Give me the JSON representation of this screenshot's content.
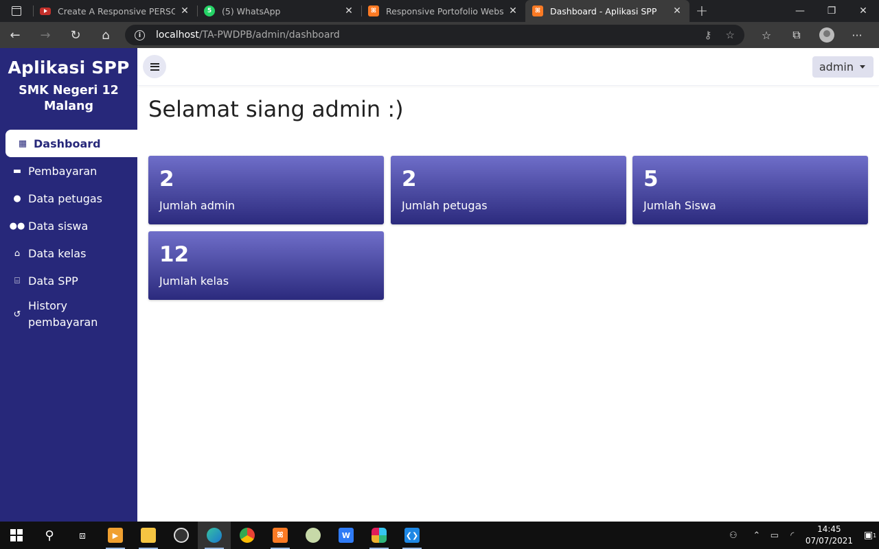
{
  "browser": {
    "tabs": [
      {
        "title": "Create A Responsive PERSONAL",
        "favicon": "youtube-icon",
        "active": false
      },
      {
        "title": "(5) WhatsApp",
        "favicon": "whatsapp-icon",
        "active": false
      },
      {
        "title": "Responsive Portofolio Website",
        "favicon": "xampp-icon",
        "active": false
      },
      {
        "title": "Dashboard - Aplikasi SPP",
        "favicon": "xampp-icon",
        "active": true
      }
    ],
    "url_host": "localhost",
    "url_path": "/TA-PWDPB/admin/dashboard",
    "whatsapp_badge": "5"
  },
  "sidebar": {
    "app_name": "Aplikasi SPP",
    "school": "SMK Negeri 12 Malang",
    "items": [
      {
        "label": "Dashboard",
        "icon": "grid-icon",
        "active": true
      },
      {
        "label": "Pembayaran",
        "icon": "card-icon",
        "active": false
      },
      {
        "label": "Data petugas",
        "icon": "user-icon",
        "active": false
      },
      {
        "label": "Data siswa",
        "icon": "users-icon",
        "active": false
      },
      {
        "label": "Data kelas",
        "icon": "school-icon",
        "active": false
      },
      {
        "label": "Data SPP",
        "icon": "bank-icon",
        "active": false
      },
      {
        "label": "History pembayaran",
        "icon": "history-icon",
        "active": false
      }
    ]
  },
  "topnav": {
    "user": "admin"
  },
  "main": {
    "greeting": "Selamat siang admin :)",
    "cards": [
      {
        "value": "2",
        "label": "Jumlah admin"
      },
      {
        "value": "2",
        "label": "Jumlah petugas"
      },
      {
        "value": "5",
        "label": "Jumlah Siswa"
      },
      {
        "value": "12",
        "label": "Jumlah kelas"
      }
    ]
  },
  "taskbar": {
    "time": "14:45",
    "date": "07/07/2021",
    "notifications": "1"
  },
  "colors": {
    "sidebar": "#27287a",
    "card_top": "#6f6ec9",
    "card_bottom": "#2b2a7d"
  }
}
